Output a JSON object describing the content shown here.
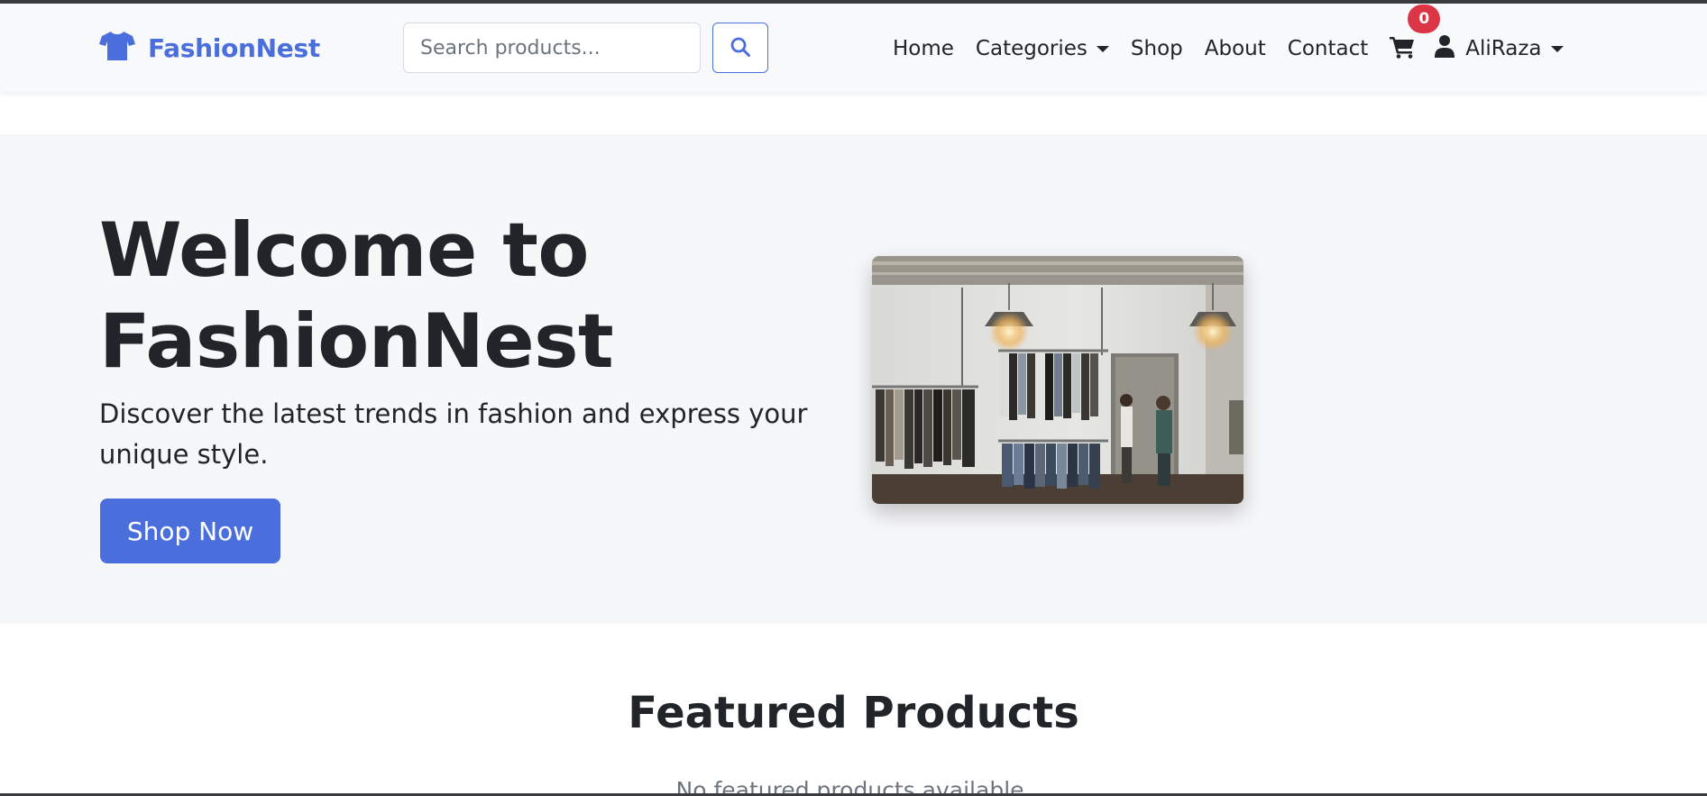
{
  "navbar": {
    "brand": "FashionNest",
    "brand_icon": "tshirt-icon",
    "search_placeholder": "Search products...",
    "search_icon": "search-icon",
    "links": [
      "Home",
      "Categories",
      "Shop",
      "About",
      "Contact"
    ],
    "cart_count": "0",
    "cart_icon": "cart-icon",
    "user_icon": "user-icon",
    "user_name": "AliRaza"
  },
  "hero": {
    "title_line1": "Welcome to",
    "title_line2": "FashionNest",
    "subtitle": "Discover the latest trends in fashion and express your unique style.",
    "cta_label": "Shop Now"
  },
  "featured": {
    "title": "Featured Products",
    "empty_message": "No featured products available."
  },
  "colors": {
    "brand": "#4a6fdc",
    "badge": "#dc3545",
    "hero_bg": "#f6f7f9",
    "navbar_bg": "#f8f9fa"
  }
}
